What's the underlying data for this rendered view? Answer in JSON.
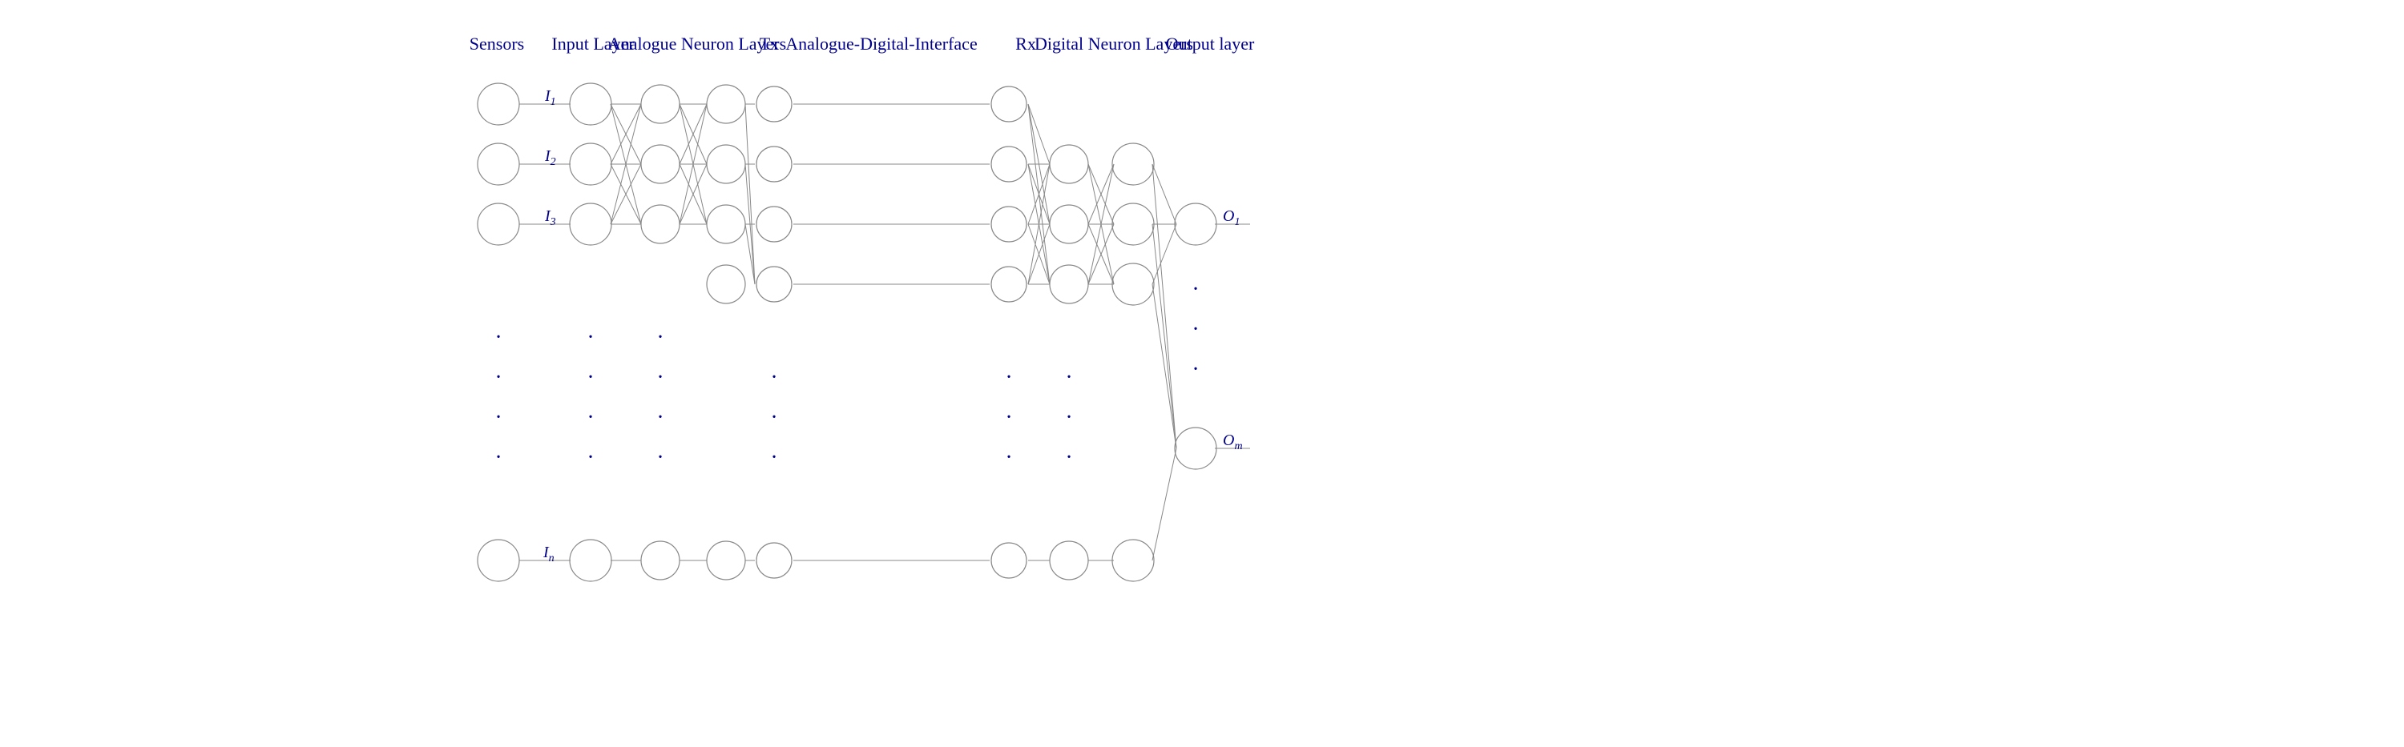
{
  "colors": {
    "blue": "#00008B",
    "stroke": "#888888",
    "background": "#ffffff"
  },
  "labels": {
    "sensors": "Sensors",
    "inputLayer": "Input Layer",
    "analogueNeuronLayers": "Analogue Neuron Layers",
    "tx": "Tx",
    "analogueDigitalInterface": "Analogue-Digital-Interface",
    "rx": "Rx",
    "digitalNeuronLayers": "Digital Neuron Layers",
    "outputLayer": "Output layer",
    "i1": "I₁",
    "i2": "I₂",
    "i3": "I₃",
    "in": "Iₙ",
    "o1": "O₁",
    "om": "Oₘ"
  }
}
